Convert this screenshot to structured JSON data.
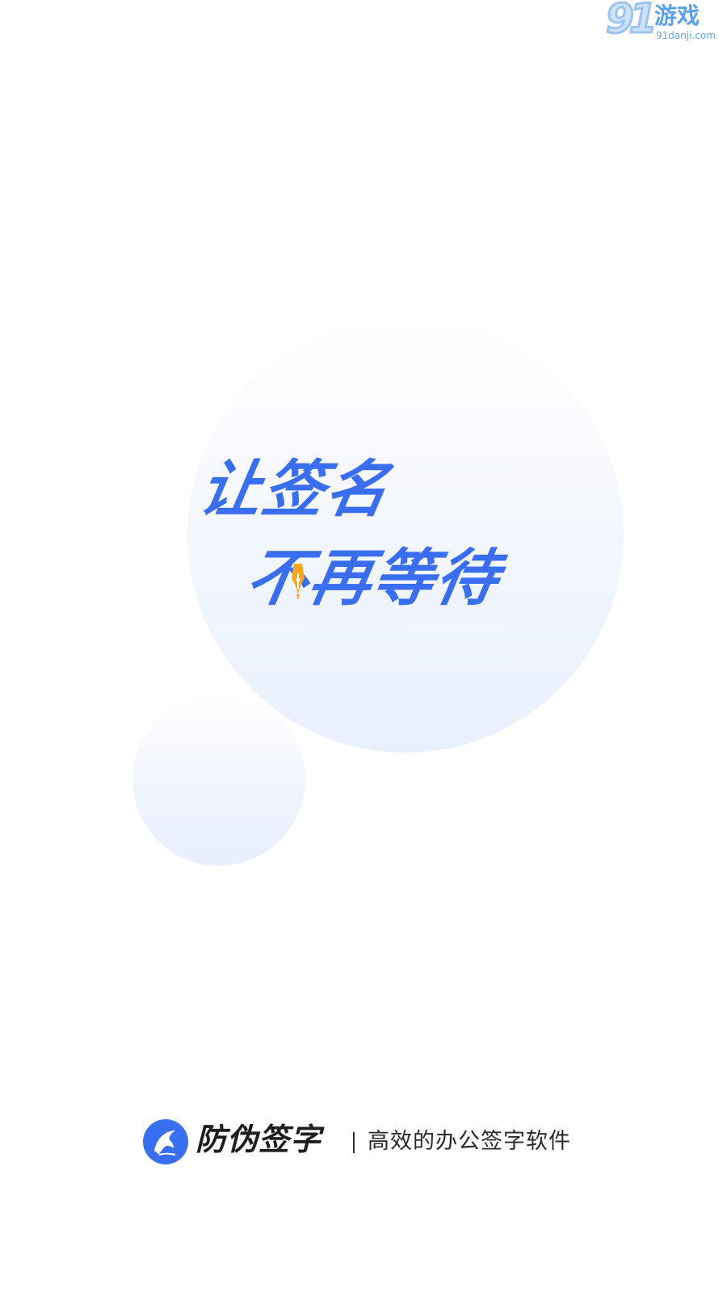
{
  "watermark": {
    "number": "91",
    "label": "游戏",
    "site": "91danji.com"
  },
  "slogan": {
    "line1": "让签名",
    "line2": "不再等待"
  },
  "brand": {
    "logo_icon": "dolphin-icon",
    "name": "防伪签字",
    "tagline": "高效的办公签字软件"
  },
  "colors": {
    "accent": "#3a6ef0",
    "pen_accent": "#f5a623",
    "text_dark": "#1e1e1e"
  }
}
